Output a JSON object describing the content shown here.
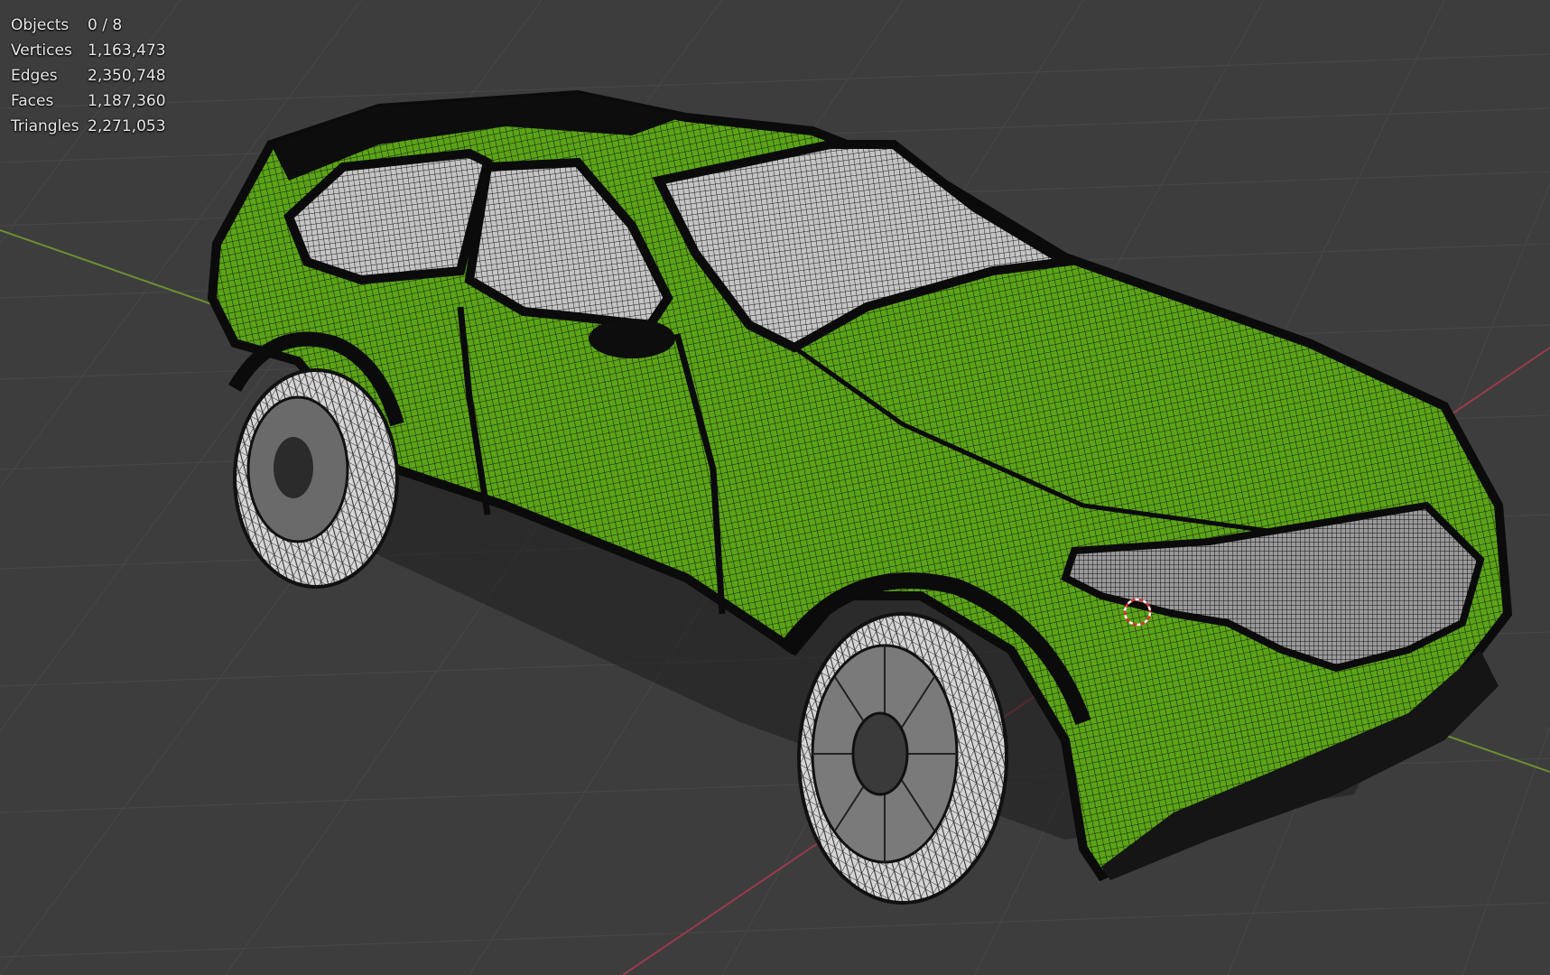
{
  "stats": {
    "objects": {
      "label": "Objects",
      "value": "0 / 8"
    },
    "vertices": {
      "label": "Vertices",
      "value": "1,163,473"
    },
    "edges": {
      "label": "Edges",
      "value": "2,350,748"
    },
    "faces": {
      "label": "Faces",
      "value": "1,187,360"
    },
    "triangles": {
      "label": "Triangles",
      "value": "2,271,053"
    }
  },
  "colors": {
    "background": "#3d3d3d",
    "grid": "#4a4a4a",
    "x_axis": "#9a3b48",
    "y_axis": "#6c8f33",
    "mesh_green": "#5aa516",
    "mesh_dark": "#0d0d0d",
    "glass": "#bdbdbd",
    "tire": "#d9d9d9"
  }
}
